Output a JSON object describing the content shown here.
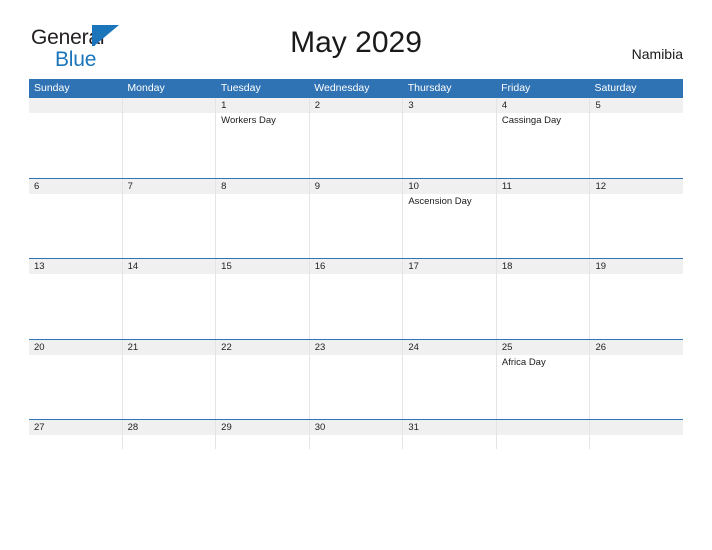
{
  "brand": {
    "name_part1": "General",
    "name_part2": "Blue",
    "accent_color": "#1b75bb"
  },
  "header": {
    "title": "May 2029",
    "region": "Namibia"
  },
  "calendar": {
    "month": "May",
    "year": "2029",
    "header_color": "#3073b4",
    "daynum_band_color": "#f0f0f0",
    "weekdays": [
      "Sunday",
      "Monday",
      "Tuesday",
      "Wednesday",
      "Thursday",
      "Friday",
      "Saturday"
    ],
    "weeks": [
      {
        "days": [
          {
            "num": "",
            "events": []
          },
          {
            "num": "",
            "events": []
          },
          {
            "num": "1",
            "events": [
              "Workers Day"
            ]
          },
          {
            "num": "2",
            "events": []
          },
          {
            "num": "3",
            "events": []
          },
          {
            "num": "4",
            "events": [
              "Cassinga Day"
            ]
          },
          {
            "num": "5",
            "events": []
          }
        ]
      },
      {
        "days": [
          {
            "num": "6",
            "events": []
          },
          {
            "num": "7",
            "events": []
          },
          {
            "num": "8",
            "events": []
          },
          {
            "num": "9",
            "events": []
          },
          {
            "num": "10",
            "events": [
              "Ascension Day"
            ]
          },
          {
            "num": "11",
            "events": []
          },
          {
            "num": "12",
            "events": []
          }
        ]
      },
      {
        "days": [
          {
            "num": "13",
            "events": []
          },
          {
            "num": "14",
            "events": []
          },
          {
            "num": "15",
            "events": []
          },
          {
            "num": "16",
            "events": []
          },
          {
            "num": "17",
            "events": []
          },
          {
            "num": "18",
            "events": []
          },
          {
            "num": "19",
            "events": []
          }
        ]
      },
      {
        "days": [
          {
            "num": "20",
            "events": []
          },
          {
            "num": "21",
            "events": []
          },
          {
            "num": "22",
            "events": []
          },
          {
            "num": "23",
            "events": []
          },
          {
            "num": "24",
            "events": []
          },
          {
            "num": "25",
            "events": [
              "Africa Day"
            ]
          },
          {
            "num": "26",
            "events": []
          }
        ]
      },
      {
        "days": [
          {
            "num": "27",
            "events": []
          },
          {
            "num": "28",
            "events": []
          },
          {
            "num": "29",
            "events": []
          },
          {
            "num": "30",
            "events": []
          },
          {
            "num": "31",
            "events": []
          },
          {
            "num": "",
            "events": []
          },
          {
            "num": "",
            "events": []
          }
        ]
      }
    ]
  }
}
